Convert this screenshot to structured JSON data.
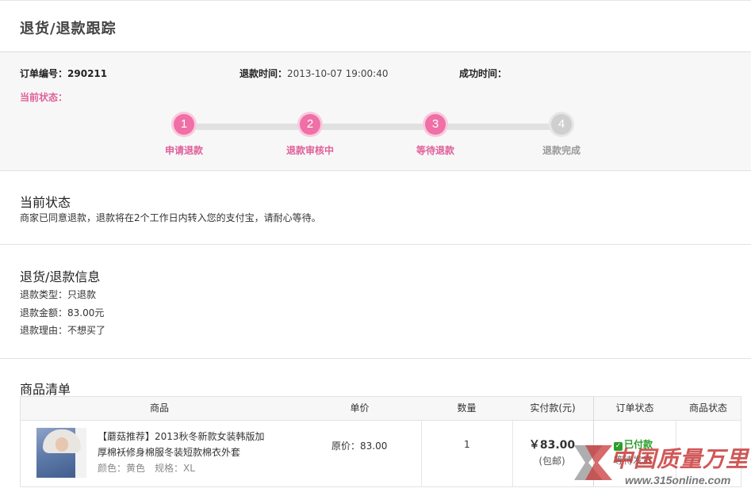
{
  "page": {
    "title": "退货/退款跟踪"
  },
  "order": {
    "number_label": "订单编号：",
    "number": "290211",
    "refund_time_label": "退款时间：",
    "refund_time": "2013-10-07 19:00:40",
    "success_time_label": "成功时间：",
    "success_time": ""
  },
  "progress": {
    "label": "当前状态：",
    "steps": [
      {
        "num": "1",
        "label": "申请退款"
      },
      {
        "num": "2",
        "label": "退款审核中"
      },
      {
        "num": "3",
        "label": "等待退款"
      },
      {
        "num": "4",
        "label": "退款完成"
      }
    ],
    "completed_steps": 3,
    "colors": {
      "done": "#ef6fa6",
      "todo": "#cfcfcf"
    }
  },
  "current_status": {
    "title": "当前状态",
    "message": "商家已同意退款，退款将在2个工作日内转入您的支付宝，请耐心等待。"
  },
  "refund_info": {
    "title": "退货/退款信息",
    "lines": [
      "退款类型：只退款",
      "退款金额：83.00元",
      "退款理由：不想买了"
    ]
  },
  "goods": {
    "title": "商品清单",
    "columns": [
      "商品",
      "单价",
      "数量",
      "实付款(元)",
      "订单状态",
      "商品状态"
    ],
    "items": [
      {
        "name": "【蘑菇推荐】2013秋冬新款女装韩版加厚棉袄修身棉服冬装短款棉衣外套",
        "spec": "颜色：黄色　规格：XL",
        "unit_price": "原价：83.00",
        "quantity": "1",
        "paid": "￥83.00",
        "paid_note": "(包邮)",
        "order_status": "已付款",
        "order_status_sub": "等待发货",
        "goods_status": ""
      }
    ]
  },
  "watermark": {
    "text": "中国质量万里行",
    "url": "www.315online.com"
  }
}
